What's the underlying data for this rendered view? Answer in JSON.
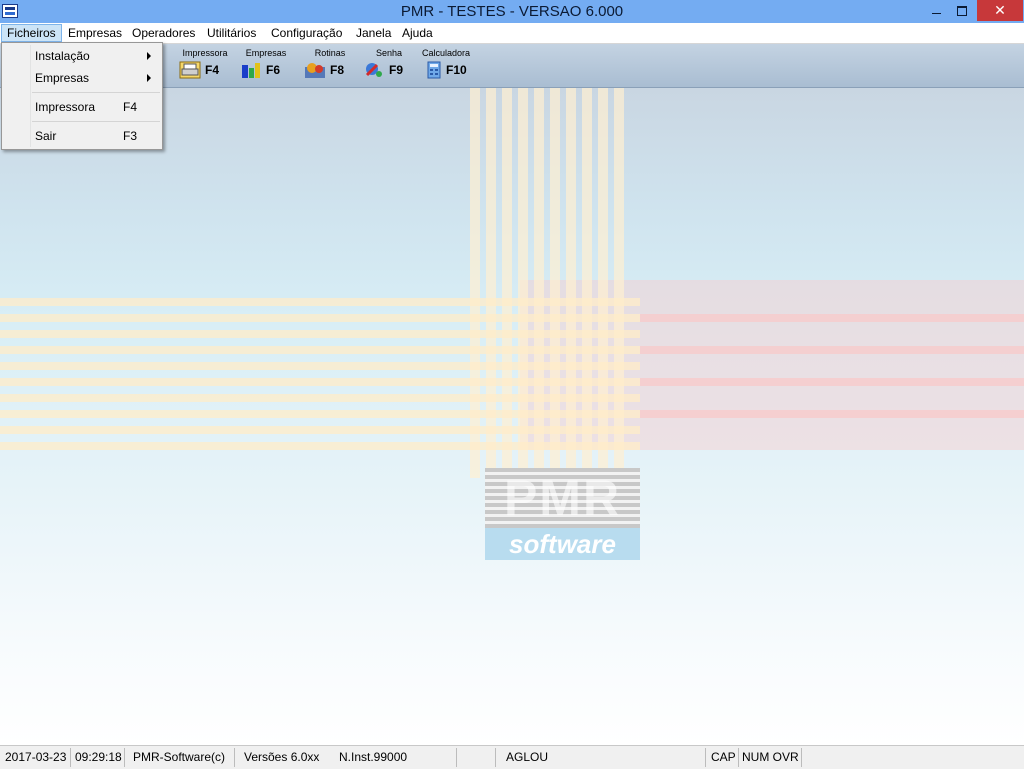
{
  "window": {
    "title": "PMR - TESTES - VERSAO 6.000",
    "minimize_symbol": "",
    "close_symbol": "✕"
  },
  "menu": {
    "items": [
      "Ficheiros",
      "Empresas",
      "Operadores",
      "Utilitários",
      "Configuração",
      "Janela",
      "Ajuda"
    ],
    "active": "Ficheiros"
  },
  "dropdown": {
    "items": [
      {
        "label": "Instalação",
        "shortcut": ""
      },
      {
        "label": "Empresas",
        "shortcut": ""
      },
      {
        "label": "Impressora",
        "shortcut": "F4"
      },
      {
        "label": "Sair",
        "shortcut": "F3"
      }
    ]
  },
  "toolbar": {
    "tools": [
      {
        "label": "Impressora",
        "key": "F4",
        "icon": "printer-icon"
      },
      {
        "label": "Empresas",
        "key": "F6",
        "icon": "companies-icon"
      },
      {
        "label": "Rotinas",
        "key": "F8",
        "icon": "routines-icon"
      },
      {
        "label": "Senha",
        "key": "F9",
        "icon": "password-icon"
      },
      {
        "label": "Calculadora",
        "key": "F10",
        "icon": "calculator-icon"
      }
    ]
  },
  "logo": {
    "brand": "PMR",
    "sub": "software"
  },
  "status": {
    "date": "2017-03-23",
    "time": "09:29:18",
    "company": "PMR-Software(c)",
    "version": "Versões 6.0xx",
    "install": "N.Inst.99000",
    "user": "AGLOU",
    "cap": "CAP",
    "num_ovr": "NUM OVR"
  },
  "colors": {
    "titlebar": "#74acf2",
    "close": "#c7383a",
    "menu_active": "#cce4f7"
  }
}
